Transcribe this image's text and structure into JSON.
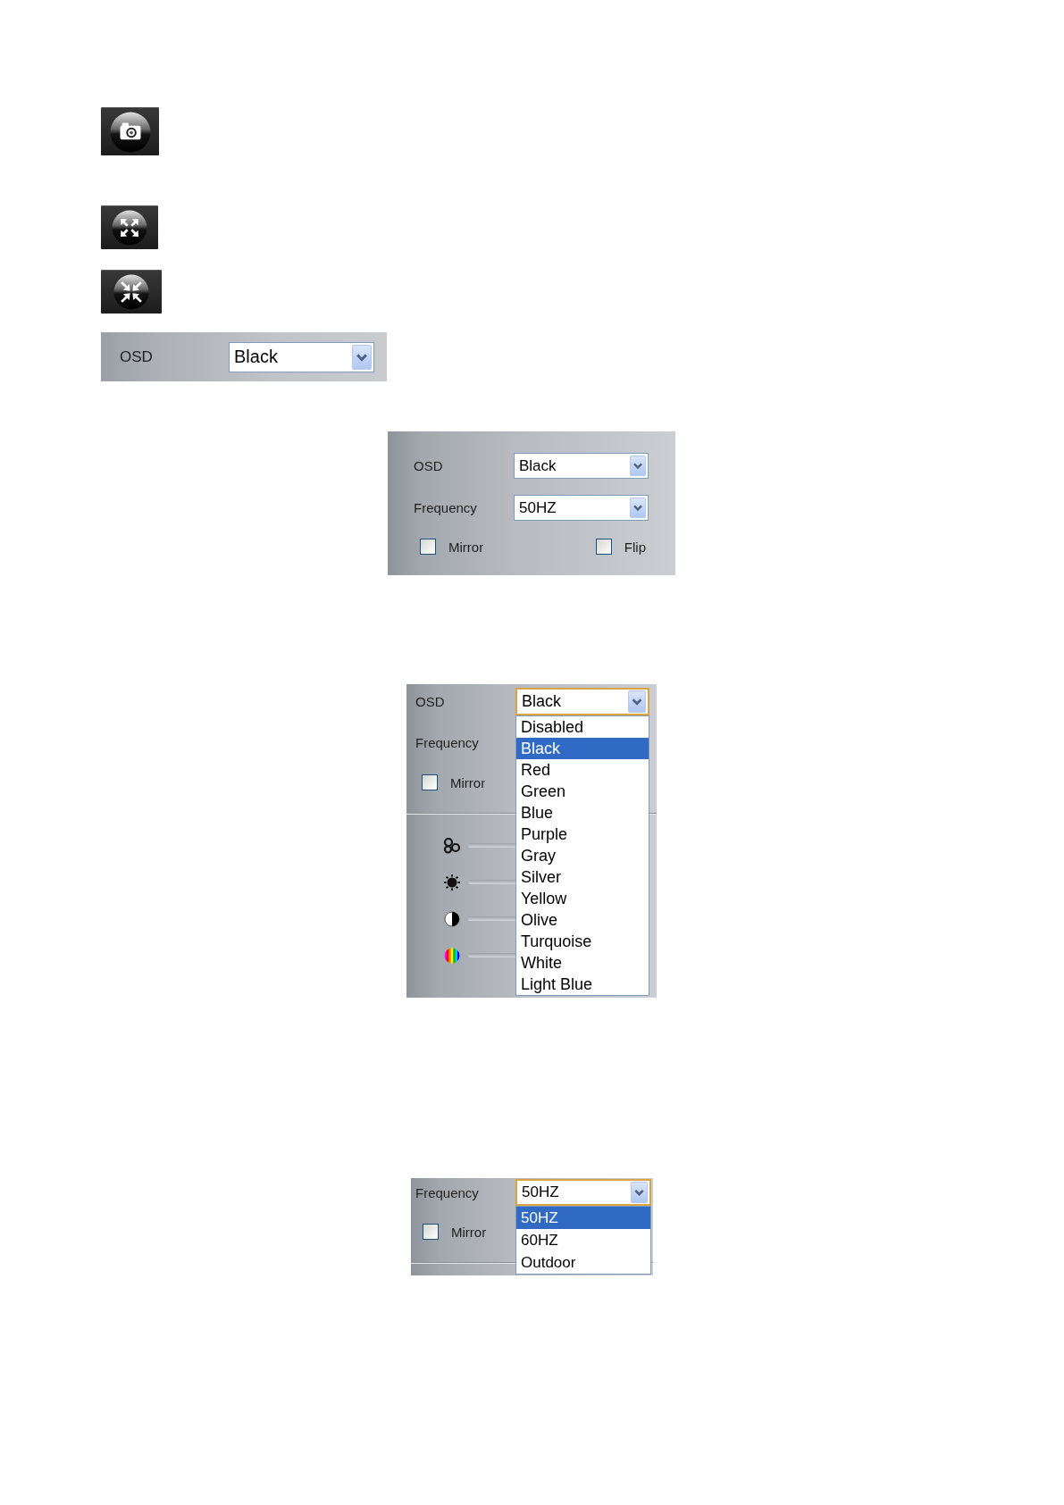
{
  "icon_buttons": [
    {
      "kind": "camera"
    },
    {
      "kind": "expand"
    },
    {
      "kind": "collapse"
    }
  ],
  "osd_bar": {
    "label": "OSD",
    "value": "Black",
    "expanded": false
  },
  "settings_panel": {
    "fields": [
      {
        "label": "OSD",
        "value": "Black",
        "expanded": false
      },
      {
        "label": "Frequency",
        "value": "50HZ",
        "expanded": false
      }
    ],
    "checkboxes": [
      {
        "label": "Mirror",
        "checked": false
      },
      {
        "label": "Flip",
        "checked": false
      }
    ]
  },
  "osd_menu_panel": {
    "fields": [
      {
        "label": "OSD",
        "value": "Black",
        "expanded": true,
        "options": [
          {
            "label": "Disabled",
            "selected": false
          },
          {
            "label": "Black",
            "selected": true
          },
          {
            "label": "Red",
            "selected": false
          },
          {
            "label": "Green",
            "selected": false
          },
          {
            "label": "Blue",
            "selected": false
          },
          {
            "label": "Purple",
            "selected": false
          },
          {
            "label": "Gray",
            "selected": false
          },
          {
            "label": "Silver",
            "selected": false
          },
          {
            "label": "Yellow",
            "selected": false
          },
          {
            "label": "Olive",
            "selected": false
          },
          {
            "label": "Turquoise",
            "selected": false
          },
          {
            "label": "White",
            "selected": false
          },
          {
            "label": "Light Blue",
            "selected": false
          }
        ]
      },
      {
        "label": "Frequency"
      }
    ],
    "checkboxes": [
      {
        "label": "Mirror",
        "checked": false
      }
    ],
    "sliders": [
      {
        "kind": "saturation"
      },
      {
        "kind": "brightness"
      },
      {
        "kind": "contrast"
      },
      {
        "kind": "hue"
      }
    ]
  },
  "frequency_menu_panel": {
    "fields": [
      {
        "label": "Frequency",
        "value": "50HZ",
        "expanded": true,
        "options": [
          {
            "label": "50HZ",
            "selected": true
          },
          {
            "label": "60HZ",
            "selected": false
          },
          {
            "label": "Outdoor",
            "selected": false
          }
        ]
      }
    ],
    "checkboxes": [
      {
        "label": "Mirror",
        "checked": false
      }
    ]
  }
}
